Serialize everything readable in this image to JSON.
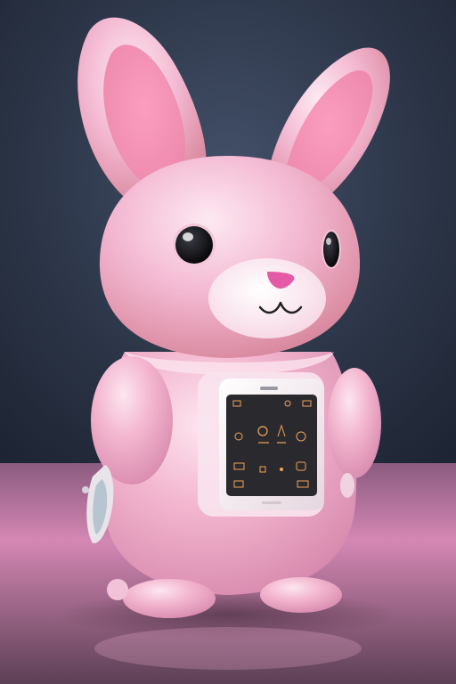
{
  "scene": {
    "subject": "pink-bunny-robot",
    "palette": {
      "background_top": "#2b3446",
      "background_bottom": "#1f2636",
      "floor": "#c77aa6",
      "body_pink": "#f3b6cf",
      "body_highlight": "#fbe3ee",
      "inner_ear": "#f59bb9",
      "nose": "#e45aa7",
      "device_frame": "#f4eef2",
      "device_screen": "#2a2a2e",
      "screen_icon": "#f0a35a"
    },
    "device": {
      "screen_icons": [
        "grid-icon",
        "settings-icon",
        "bell-icon",
        "phone-icon",
        "camera-icon",
        "music-icon",
        "heart-icon",
        "battery-icon",
        "menu-icon",
        "mail-icon",
        "star-icon",
        "lock-icon"
      ]
    }
  }
}
